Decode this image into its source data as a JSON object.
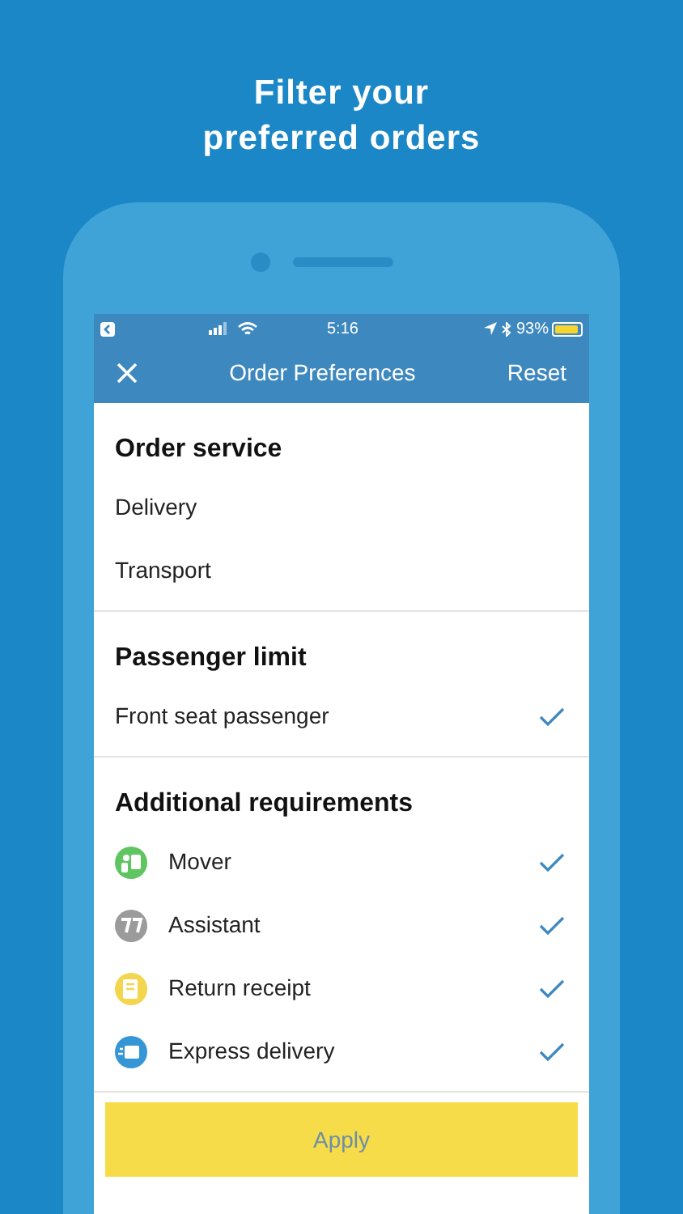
{
  "headline": [
    "Filter your",
    "preferred orders"
  ],
  "status_bar": {
    "time": "5:16",
    "battery": "93%"
  },
  "nav": {
    "title": "Order Preferences",
    "right": "Reset"
  },
  "sections": [
    {
      "title": "Order service",
      "rows": [
        {
          "label": "Delivery",
          "selected": false
        },
        {
          "label": "Transport",
          "selected": false
        }
      ]
    },
    {
      "title": "Passenger limit",
      "rows": [
        {
          "label": "Front seat passenger",
          "selected": true
        }
      ]
    },
    {
      "title": "Additional requirements",
      "rows": [
        {
          "label": "Mover",
          "selected": true,
          "color": "#5fc561"
        },
        {
          "label": "Assistant",
          "selected": true,
          "color": "#9b9b9b"
        },
        {
          "label": "Return receipt",
          "selected": true,
          "color": "#f3d54e"
        },
        {
          "label": "Express delivery",
          "selected": true,
          "color": "#3596d6"
        }
      ]
    }
  ],
  "apply_button": "Apply"
}
